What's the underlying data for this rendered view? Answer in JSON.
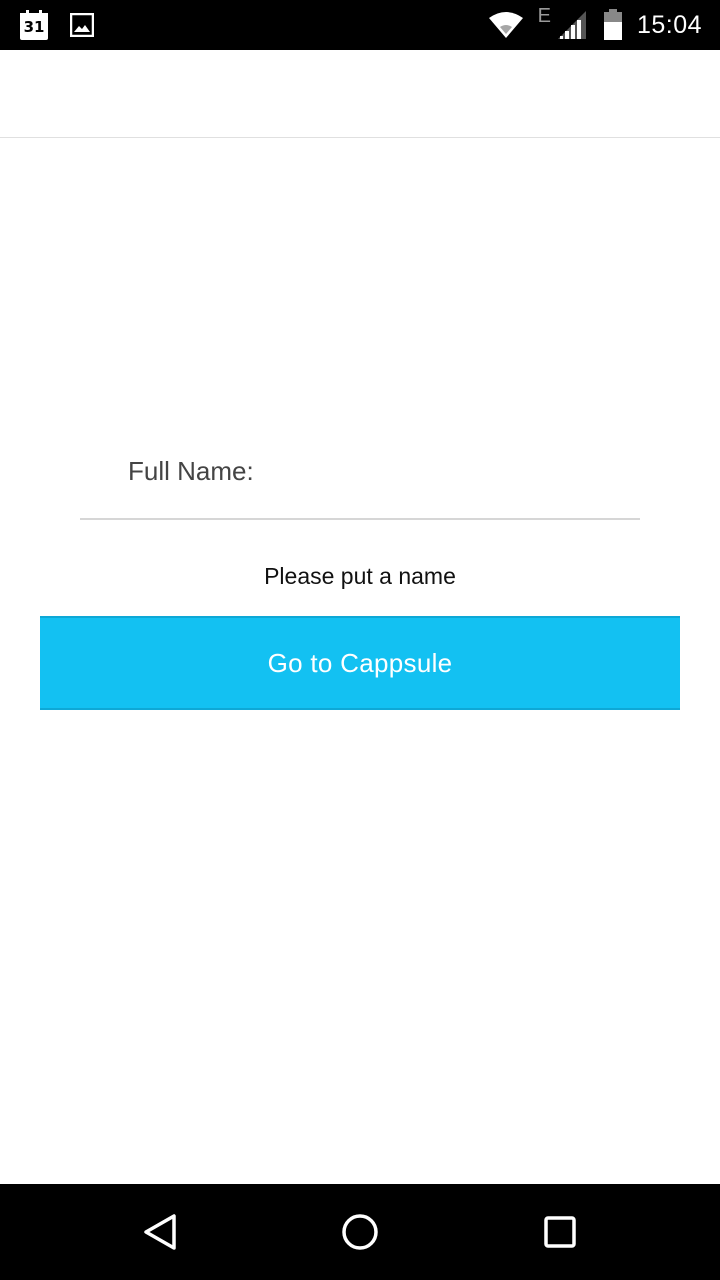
{
  "status_bar": {
    "calendar_day": "31",
    "network_type": "E",
    "time": "15:04",
    "icons": [
      "calendar-icon",
      "image-icon",
      "wifi-icon",
      "cell-signal-icon",
      "battery-icon"
    ]
  },
  "form": {
    "name_label": "Full Name:",
    "name_value": "",
    "hint": "Please put a name"
  },
  "actions": {
    "go_label": "Go to Cappsule"
  },
  "colors": {
    "accent": "#13c1f2",
    "status_bar_bg": "#000000",
    "nav_bar_bg": "#000000"
  },
  "nav_bar": {
    "icons": [
      "back-icon",
      "home-icon",
      "recent-apps-icon"
    ]
  }
}
